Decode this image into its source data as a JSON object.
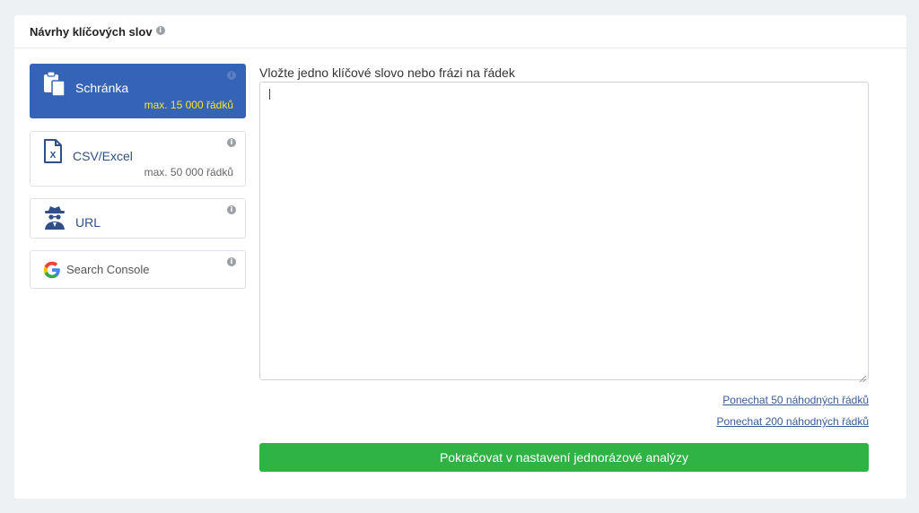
{
  "panel": {
    "title": "Návrhy klíčových slov",
    "info_icon": "info-circle-icon"
  },
  "sources": [
    {
      "label": "Schránka",
      "limit": "max. 15 000 řádků",
      "icon": "clipboard-icon",
      "active": true
    },
    {
      "label": "CSV/Excel",
      "limit": "max. 50 000 řádků",
      "icon": "excel-file-icon",
      "active": false
    },
    {
      "label": "URL",
      "icon": "spy-icon",
      "active": false
    },
    {
      "label": "Search Console",
      "icon": "google-icon",
      "active": false
    }
  ],
  "input": {
    "label": "Vložte jedno klíčové slovo nebo frázi na řádek",
    "value": ""
  },
  "links": {
    "keep_50": "Ponechat 50 náhodných řádků",
    "keep_200": "Ponechat 200 náhodných řádků"
  },
  "submit_label": "Pokračovat v nastavení jednorázové analýzy",
  "colors": {
    "active_card": "#3563b6",
    "limit_highlight": "#f5e52c",
    "submit": "#2fb344",
    "link": "#3b5b98"
  }
}
